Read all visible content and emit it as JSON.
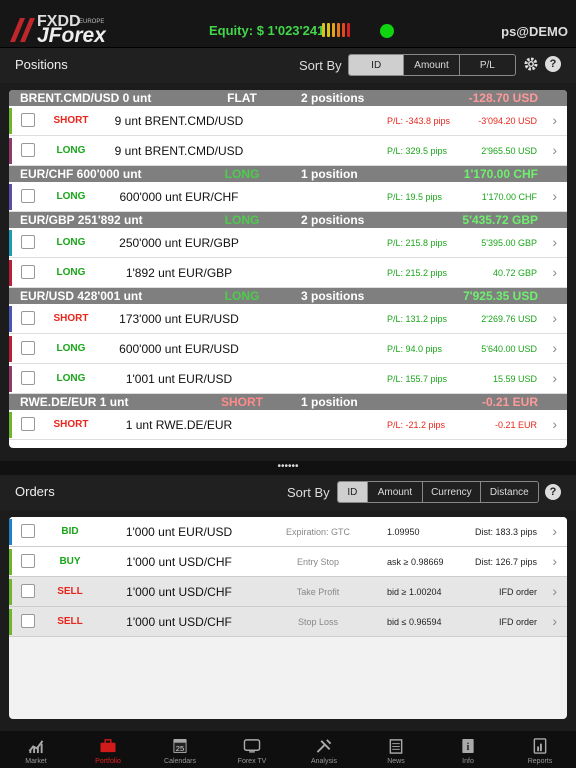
{
  "header": {
    "logo_fxdd": "FXDD",
    "logo_europe": "EUROPE",
    "logo_jforex": "JForex",
    "equity_label": "Equity:",
    "equity_value": "$ 1'023'241",
    "user": "ps@DEMO"
  },
  "positions_bar": {
    "title": "Positions",
    "sort_label": "Sort By",
    "sort_options": [
      "ID",
      "Amount",
      "P/L"
    ],
    "sort_active": "ID"
  },
  "positions": [
    {
      "header": {
        "name": "BRENT.CMD/USD 0 unt",
        "side": "FLAT",
        "count": "2 positions",
        "pl": "-128.70 USD"
      },
      "rows": [
        {
          "side": "SHORT",
          "desc": "9 unt BRENT.CMD/USD",
          "pips": "P/L: -343.8 pips",
          "amt": "-3'094.20 USD"
        },
        {
          "side": "LONG",
          "desc": "9 unt BRENT.CMD/USD",
          "pips": "P/L: 329.5 pips",
          "amt": "2'965.50 USD"
        }
      ]
    },
    {
      "header": {
        "name": "EUR/CHF 600'000 unt",
        "side": "LONG",
        "count": "1 position",
        "pl": "1'170.00 CHF"
      },
      "rows": [
        {
          "side": "LONG",
          "desc": "600'000 unt EUR/CHF",
          "pips": "P/L: 19.5 pips",
          "amt": "1'170.00 CHF"
        }
      ]
    },
    {
      "header": {
        "name": "EUR/GBP 251'892 unt",
        "side": "LONG",
        "count": "2 positions",
        "pl": "5'435.72 GBP"
      },
      "rows": [
        {
          "side": "LONG",
          "desc": "250'000 unt EUR/GBP",
          "pips": "P/L: 215.8 pips",
          "amt": "5'395.00 GBP"
        },
        {
          "side": "LONG",
          "desc": "1'892 unt EUR/GBP",
          "pips": "P/L: 215.2 pips",
          "amt": "40.72 GBP"
        }
      ]
    },
    {
      "header": {
        "name": "EUR/USD 428'001 unt",
        "side": "LONG",
        "count": "3 positions",
        "pl": "7'925.35 USD"
      },
      "rows": [
        {
          "side": "SHORT",
          "desc": "173'000 unt EUR/USD",
          "pips": "P/L: 131.2 pips",
          "amt": "2'269.76 USD"
        },
        {
          "side": "LONG",
          "desc": "600'000 unt EUR/USD",
          "pips": "P/L: 94.0 pips",
          "amt": "5'640.00 USD"
        },
        {
          "side": "LONG",
          "desc": "1'001 unt EUR/USD",
          "pips": "P/L: 155.7 pips",
          "amt": "15.59 USD"
        }
      ]
    },
    {
      "header": {
        "name": "RWE.DE/EUR 1 unt",
        "side": "SHORT",
        "count": "1 position",
        "pl": "-0.21 EUR"
      },
      "rows": [
        {
          "side": "SHORT",
          "desc": "1 unt RWE.DE/EUR",
          "pips": "P/L: -21.2 pips",
          "amt": "-0.21 EUR"
        }
      ]
    }
  ],
  "divider": "••••••",
  "orders_bar": {
    "title": "Orders",
    "sort_label": "Sort By",
    "sort_options": [
      "ID",
      "Amount",
      "Currency",
      "Distance"
    ],
    "sort_active": "ID"
  },
  "orders": [
    {
      "side": "BID",
      "desc": "1'000 unt EUR/USD",
      "type": "Expiration: GTC",
      "price": "1.09950",
      "dist": "Dist: 183.3 pips"
    },
    {
      "side": "BUY",
      "desc": "1'000 unt USD/CHF",
      "type": "Entry Stop",
      "price": "ask ≥ 0.98669",
      "dist": "Dist: 126.7 pips"
    },
    {
      "side": "SELL",
      "desc": "1'000 unt USD/CHF",
      "type": "Take Profit",
      "price": "bid ≥ 1.00204",
      "dist": "IFD order"
    },
    {
      "side": "SELL",
      "desc": "1'000 unt USD/CHF",
      "type": "Stop Loss",
      "price": "bid ≤ 0.96594",
      "dist": "IFD order"
    }
  ],
  "tabs": [
    {
      "label": "Market",
      "icon": "chart-icon"
    },
    {
      "label": "Portfolio",
      "icon": "briefcase-icon",
      "active": true
    },
    {
      "label": "Calendars",
      "icon": "calendar-icon",
      "badge": "25"
    },
    {
      "label": "Forex TV",
      "icon": "tv-icon"
    },
    {
      "label": "Analysis",
      "icon": "tools-icon"
    },
    {
      "label": "News",
      "icon": "news-icon"
    },
    {
      "label": "Info",
      "icon": "info-icon",
      "badge": "i"
    },
    {
      "label": "Reports",
      "icon": "report-icon"
    }
  ],
  "colors": {
    "green": "#1aa51a",
    "red": "#e8261c",
    "accent": "#c33"
  }
}
